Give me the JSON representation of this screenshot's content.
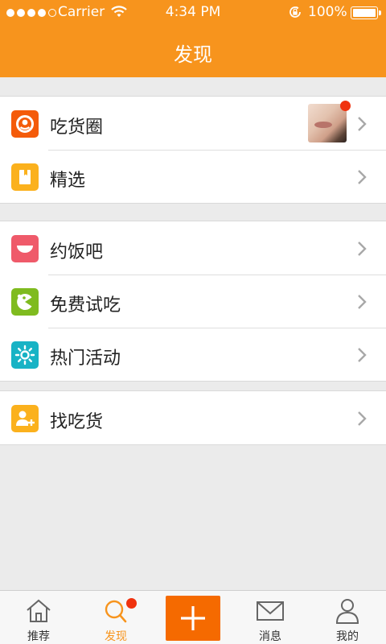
{
  "status_bar": {
    "carrier": "Carrier",
    "time": "4:34 PM",
    "battery": "100%",
    "signal_icon": "signal-dots-icon",
    "wifi_icon": "wifi-icon",
    "lock_icon": "rotation-lock-icon",
    "battery_icon": "battery-icon"
  },
  "nav": {
    "title": "发现"
  },
  "groups": [
    {
      "items": [
        {
          "label": "吃货圈",
          "icon": "chihuoquan-icon",
          "icon_color": "#f45b0a",
          "has_thumbnail": true,
          "has_badge": true
        },
        {
          "label": "精选",
          "icon": "bookmark-icon",
          "icon_color": "#fbb11d"
        }
      ]
    },
    {
      "items": [
        {
          "label": "约饭吧",
          "icon": "bowl-icon",
          "icon_color": "#ef5a6a"
        },
        {
          "label": "免费试吃",
          "icon": "pacman-icon",
          "icon_color": "#7fbb1f"
        },
        {
          "label": "热门活动",
          "icon": "sun-icon",
          "icon_color": "#18b3c5"
        }
      ]
    },
    {
      "items": [
        {
          "label": "找吃货",
          "icon": "add-user-icon",
          "icon_color": "#fbb11d"
        }
      ]
    }
  ],
  "tabbar": {
    "tabs": [
      {
        "label": "推荐",
        "icon": "home-icon",
        "active": false
      },
      {
        "label": "发现",
        "icon": "search-icon",
        "active": true,
        "has_badge": true
      },
      {
        "label": "",
        "icon": "plus-icon",
        "active": false
      },
      {
        "label": "消息",
        "icon": "envelope-icon",
        "active": false
      },
      {
        "label": "我的",
        "icon": "person-icon",
        "active": false
      }
    ]
  },
  "colors": {
    "accent": "#f7941d",
    "plus_button": "#f56a00",
    "badge": "#f0320e",
    "background": "#ebebeb"
  }
}
